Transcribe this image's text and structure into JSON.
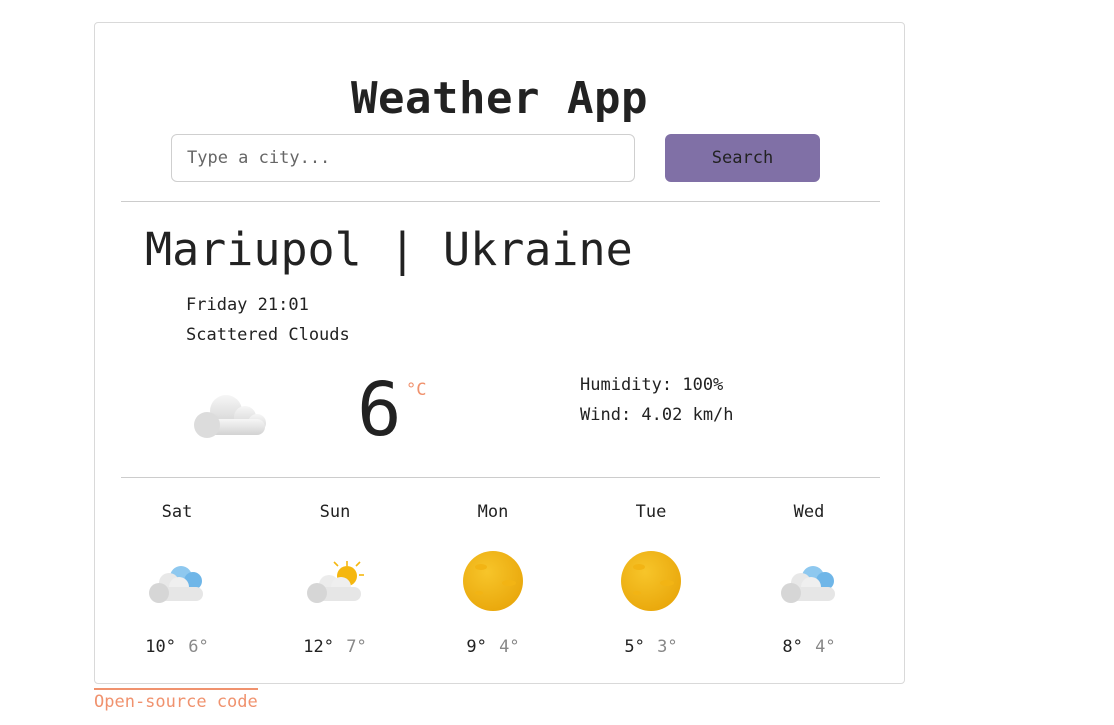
{
  "app": {
    "title": "Weather App"
  },
  "search": {
    "placeholder": "Type a city...",
    "button_label": "Search"
  },
  "current": {
    "location": "Mariupol | Ukraine",
    "datetime": "Friday 21:01",
    "description": "Scattered Clouds",
    "temperature": "6",
    "unit": "°C",
    "humidity": "Humidity: 100%",
    "wind": "Wind: 4.02 km/h",
    "icon": "cloud-icon"
  },
  "forecast": [
    {
      "day": "Sat",
      "max": "10°",
      "min": "6°",
      "icon": "cloud-blue-icon"
    },
    {
      "day": "Sun",
      "max": "12°",
      "min": "7°",
      "icon": "cloud-sun-icon"
    },
    {
      "day": "Mon",
      "max": "9°",
      "min": "4°",
      "icon": "sun-icon"
    },
    {
      "day": "Tue",
      "max": "5°",
      "min": "3°",
      "icon": "sun-icon"
    },
    {
      "day": "Wed",
      "max": "8°",
      "min": "4°",
      "icon": "cloud-blue-icon"
    }
  ],
  "footer": {
    "link_label": "Open-source code"
  },
  "colors": {
    "accent": "#8070a6",
    "link": "#f0926e",
    "sun": "#f5b70f"
  }
}
